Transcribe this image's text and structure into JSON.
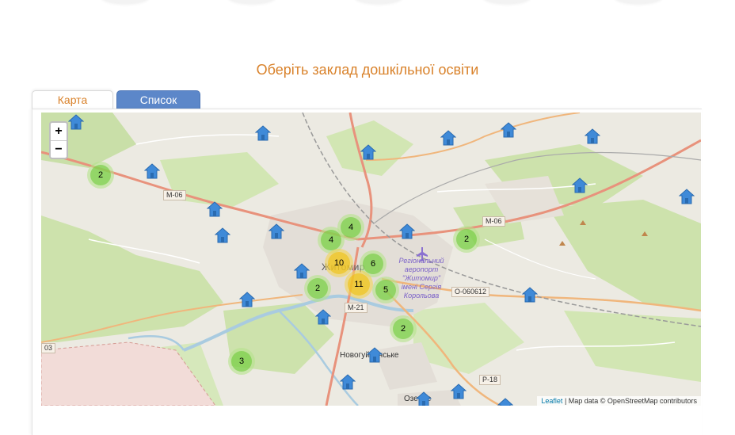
{
  "header": {
    "title": "Оберіть заклад дошкільної освіти"
  },
  "tabs": [
    {
      "label": "Карта",
      "active": true
    },
    {
      "label": "Список",
      "active": false
    }
  ],
  "map": {
    "zoom_in": "+",
    "zoom_out": "−",
    "labels": {
      "city": "Житомир",
      "novohuivynske": "Новогуйвинське",
      "ozerne": "Озерне",
      "airport": "Регіональний аеропорт \"Житомир\" імені Сергія Корольова"
    },
    "roads": [
      "M-06",
      "M-06",
      "M-21",
      "O-060612",
      "P-18",
      "03"
    ],
    "clusters": [
      "2",
      "4",
      "4",
      "10",
      "6",
      "11",
      "2",
      "5",
      "2",
      "2",
      "3"
    ],
    "attribution": {
      "leaflet": "Leaflet",
      "text": " | Map data © OpenStreetMap contributors"
    }
  },
  "colors": {
    "accent": "#d9822b",
    "tab_blue": "#5c87c9",
    "marker_blue": "#3f8ad8"
  }
}
